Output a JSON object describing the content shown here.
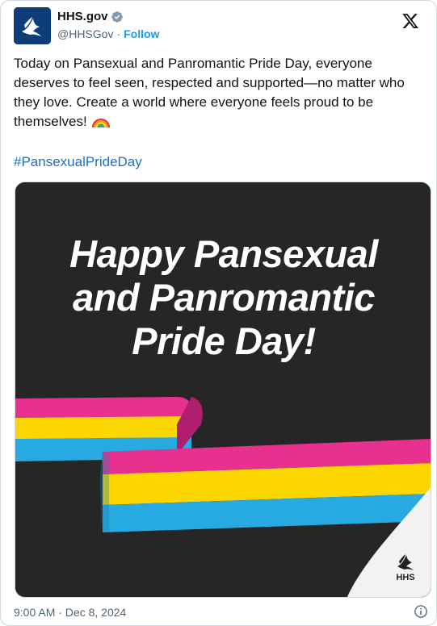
{
  "header": {
    "display_name": "HHS.gov",
    "handle": "@HHSGov",
    "separator": "·",
    "follow_label": "Follow",
    "avatar_icon": "hhs-eagle-icon",
    "verified_icon": "verified-badge-icon",
    "platform_icon": "x-logo-icon"
  },
  "post": {
    "text": "Today on Pansexual and Panromantic Pride Day, everyone deserves to feel seen, respected and supported—no matter who they love. Create a world where everyone feels proud to be themselves!",
    "emoji_icon": "rainbow-icon",
    "hashtag": "#PansexualPrideDay"
  },
  "media": {
    "headline_lines": [
      "Happy Pansexual",
      "and Panromantic",
      "Pride Day!"
    ],
    "logo_label": "HHS",
    "flag_colors": [
      "#e8308f",
      "#fcd600",
      "#27a9e1"
    ],
    "background": "#262626"
  },
  "footer": {
    "timestamp": "9:00 AM · Dec 8, 2024",
    "info_icon": "info-icon"
  },
  "colors": {
    "link": "#1d9bf0",
    "hashtag": "#1d6ec6",
    "muted": "#536471"
  }
}
